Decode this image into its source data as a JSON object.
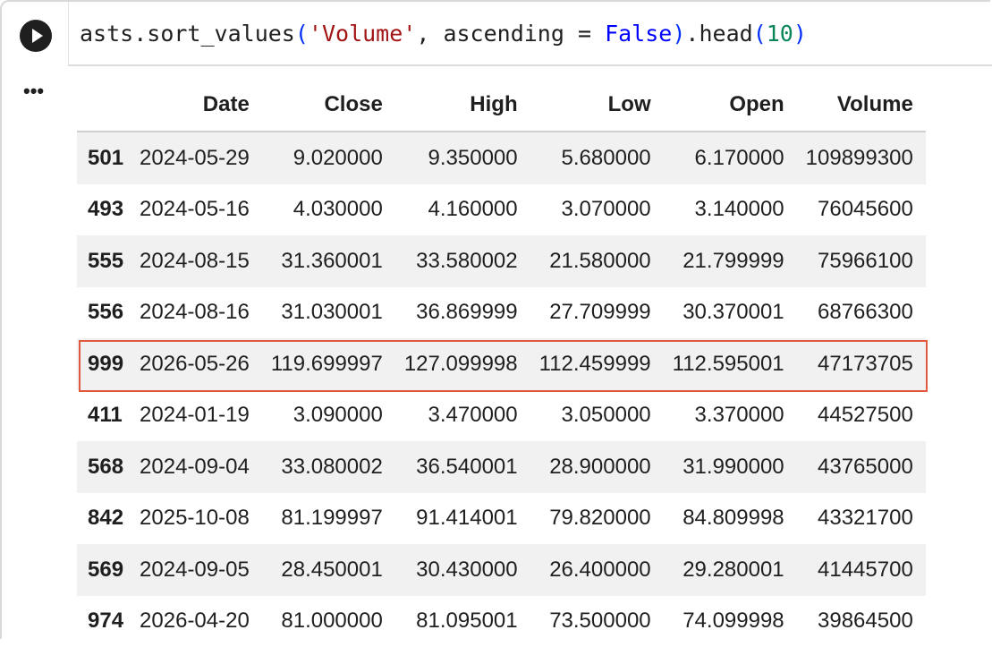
{
  "code_cell": {
    "run_label": "Run cell",
    "tokens": {
      "object": "asts",
      "dot1": ".",
      "method": "sort_values",
      "open_paren": "(",
      "arg_str": "'Volume'",
      "comma": ", ",
      "kwarg": "ascending = ",
      "kw_value": "False",
      "close_paren": ")",
      "dot2": ".",
      "method2": "head",
      "open_paren2": "(",
      "num": "10",
      "close_paren2": ")"
    }
  },
  "output": {
    "menu_label": "•••",
    "columns": [
      "",
      "Date",
      "Close",
      "High",
      "Low",
      "Open",
      "Volume"
    ],
    "rows": [
      {
        "index": "501",
        "cells": [
          "2024-05-29",
          "9.020000",
          "9.350000",
          "5.680000",
          "6.170000",
          "109899300"
        ]
      },
      {
        "index": "493",
        "cells": [
          "2024-05-16",
          "4.030000",
          "4.160000",
          "3.070000",
          "3.140000",
          "76045600"
        ]
      },
      {
        "index": "555",
        "cells": [
          "2024-08-15",
          "31.360001",
          "33.580002",
          "21.580000",
          "21.799999",
          "75966100"
        ]
      },
      {
        "index": "556",
        "cells": [
          "2024-08-16",
          "31.030001",
          "36.869999",
          "27.709999",
          "30.370001",
          "68766300"
        ]
      },
      {
        "index": "999",
        "cells": [
          "2026-05-26",
          "119.699997",
          "127.099998",
          "112.459999",
          "112.595001",
          "47173705"
        ]
      },
      {
        "index": "411",
        "cells": [
          "2024-01-19",
          "3.090000",
          "3.470000",
          "3.050000",
          "3.370000",
          "44527500"
        ]
      },
      {
        "index": "568",
        "cells": [
          "2024-09-04",
          "33.080002",
          "36.540001",
          "28.900000",
          "31.990000",
          "43765000"
        ]
      },
      {
        "index": "842",
        "cells": [
          "2025-10-08",
          "81.199997",
          "91.414001",
          "79.820000",
          "84.809998",
          "43321700"
        ]
      },
      {
        "index": "569",
        "cells": [
          "2024-09-05",
          "28.450001",
          "30.430000",
          "26.400000",
          "29.280001",
          "41445700"
        ]
      },
      {
        "index": "974",
        "cells": [
          "2026-04-20",
          "81.000000",
          "81.095001",
          "73.500000",
          "74.099998",
          "39864500"
        ]
      }
    ],
    "highlighted_row_index": "999",
    "highlight_color": "#e05a3e"
  }
}
